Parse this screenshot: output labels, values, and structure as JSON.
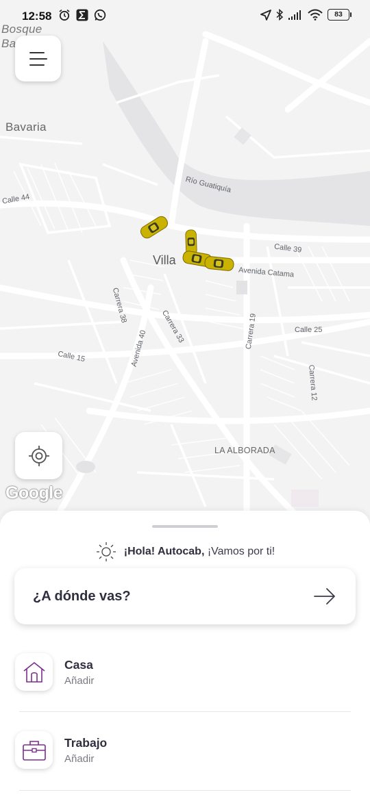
{
  "status_bar": {
    "time": "12:58",
    "battery": "83"
  },
  "map": {
    "labels": {
      "bosque": "Bosque",
      "ba": "Ba",
      "bavaria": "Bavaria",
      "rio": "Río Guatiquía",
      "calle44": "Calle 44",
      "villa": "Villa",
      "calle39": "Calle 39",
      "avenida_catama": "Avenida Catama",
      "carrera38": "Carrera 38",
      "carrera33": "Carrera 33",
      "avenida40": "Avenida 40",
      "carrera19": "Carrera 19",
      "calle25": "Calle 25",
      "calle15": "Calle 15",
      "carrera12": "Carrera 12",
      "la_alborada": "LA ALBORADA"
    },
    "attribution": "Google"
  },
  "sheet": {
    "greeting_name": "¡Hola! Autocab,",
    "greeting_rest": " ¡Vamos por ti!",
    "search_label": "¿A dónde vas?",
    "places": [
      {
        "title": "Casa",
        "subtitle": "Añadir",
        "icon": "home-icon"
      },
      {
        "title": "Trabajo",
        "subtitle": "Añadir",
        "icon": "briefcase-icon"
      }
    ]
  },
  "colors": {
    "accent": "#7b2d8e",
    "taxi": "#c9b200",
    "text_dark": "#2f2f40"
  }
}
